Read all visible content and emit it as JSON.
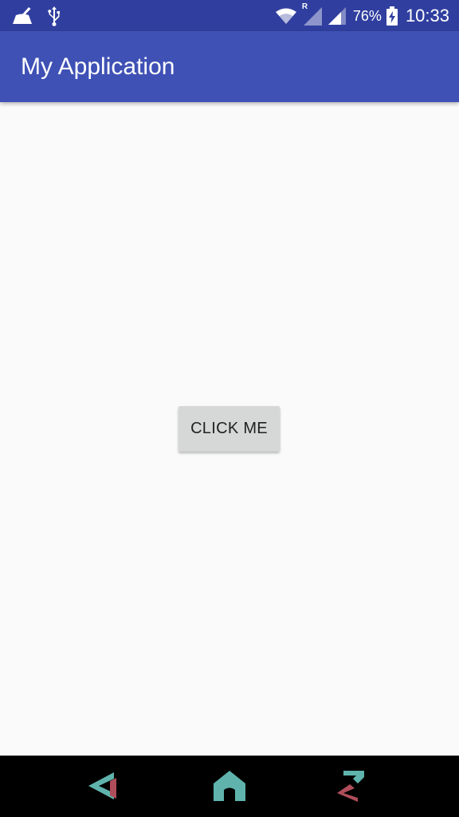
{
  "status_bar": {
    "icons_left": [
      "cleaner-icon",
      "usb-icon"
    ],
    "icons_right": [
      "wifi-icon",
      "roaming-signal-icon",
      "signal-icon",
      "battery-charging-icon"
    ],
    "roaming_indicator": "R",
    "battery_percent": "76%",
    "time": "10:33"
  },
  "app_bar": {
    "title": "My Application"
  },
  "main": {
    "button_label": "CLICK ME"
  },
  "nav_bar": {
    "buttons": [
      "back-icon",
      "home-icon",
      "recents-icon"
    ]
  },
  "colors": {
    "status_bar": "#303f9f",
    "app_bar": "#3f51b5",
    "background": "#fafafa",
    "button": "#d6d7d7",
    "nav_bar": "#000000",
    "nav_teal": "#5fb3ac",
    "nav_red": "#b04d5a"
  }
}
